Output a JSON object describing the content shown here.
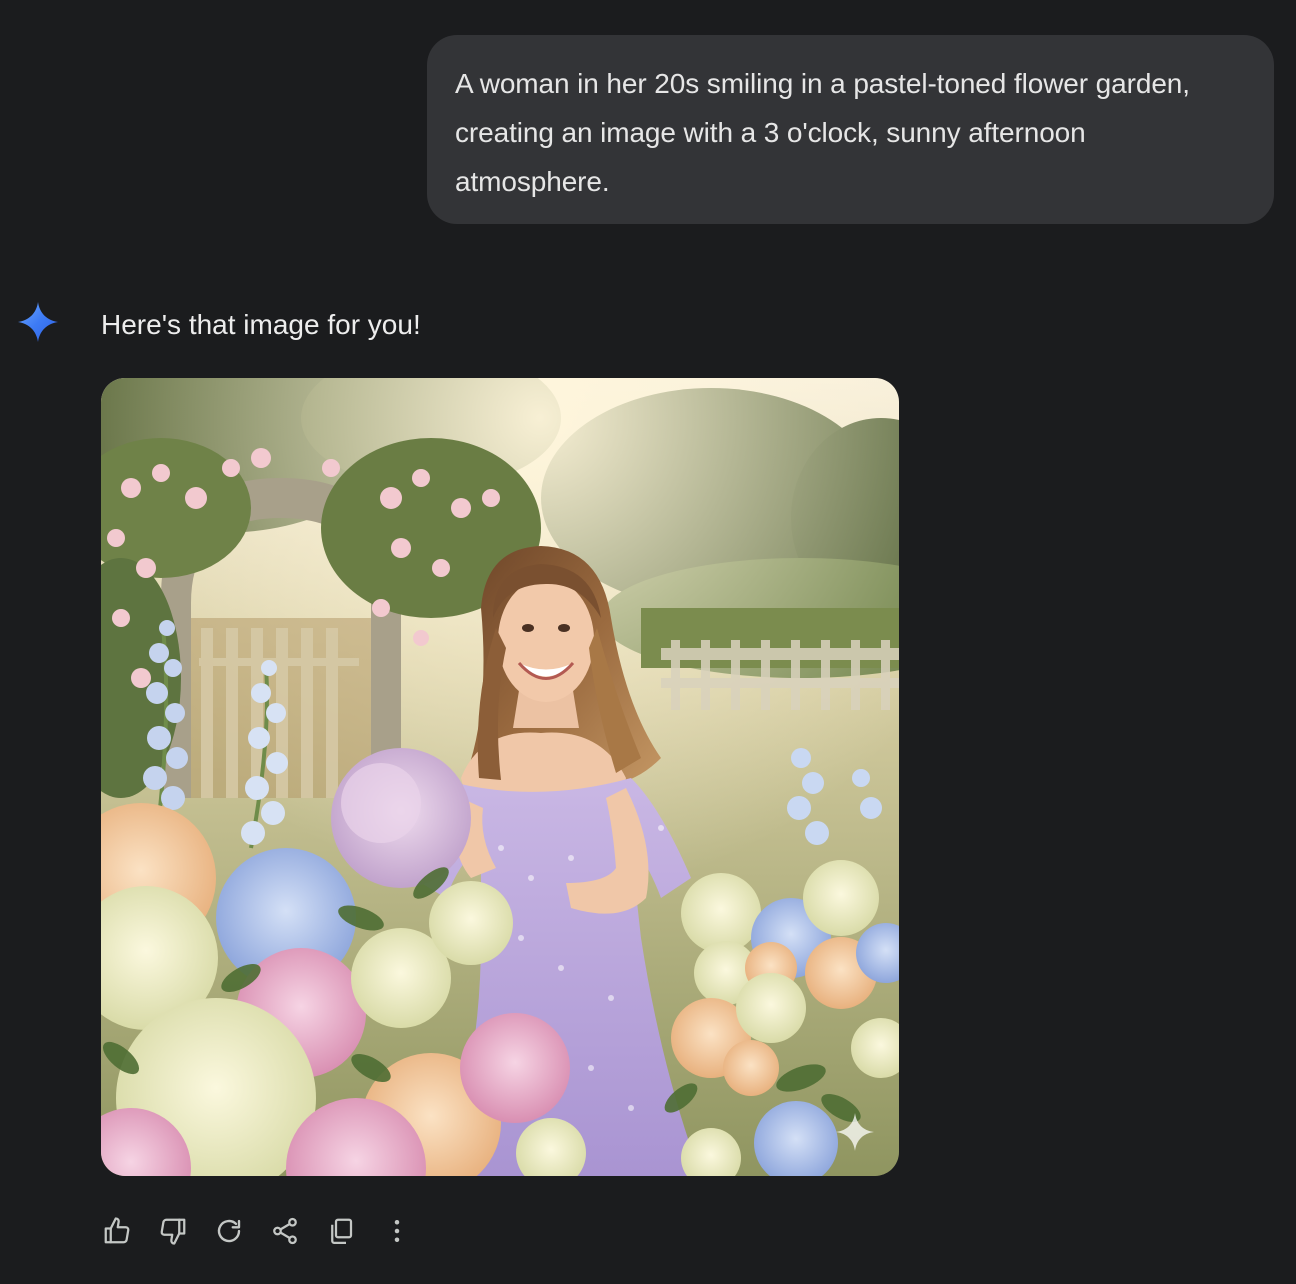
{
  "conversation": {
    "user_message": "A woman in her 20s smiling in a pastel-toned flower garden, creating an image with a 3 o'clock, sunny afternoon atmosphere.",
    "assistant_reply": "Here's that image for you!",
    "assistant_icon": "gemini-sparkle-icon"
  },
  "image": {
    "alt": "A woman in her 20s smiling in a pastel-toned flower garden on a sunny afternoon",
    "watermark_icon": "sparkle-watermark-icon"
  },
  "actions": [
    {
      "name": "thumbs-up-icon",
      "label": "Good response"
    },
    {
      "name": "thumbs-down-icon",
      "label": "Bad response"
    },
    {
      "name": "regenerate-icon",
      "label": "Redo"
    },
    {
      "name": "share-icon",
      "label": "Share"
    },
    {
      "name": "copy-icon",
      "label": "Copy"
    },
    {
      "name": "more-vert-icon",
      "label": "More"
    }
  ],
  "colors": {
    "background": "#1b1c1e",
    "user_bubble": "#333437",
    "text": "#e3e3e3",
    "icon": "#c4c7c5",
    "gemini_blue": "#4285f4"
  }
}
